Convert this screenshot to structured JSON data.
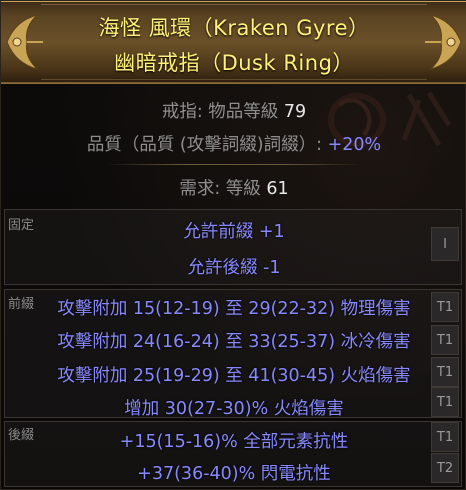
{
  "item": {
    "name_line": "海怪 風環（Kraken Gyre）",
    "base_line": "幽暗戒指（Dusk Ring）"
  },
  "properties": {
    "category_label": "戒指: 物品等級 ",
    "item_level": "79",
    "quality_label": "品質（品質 (攻擊詞綴)詞綴）: ",
    "quality_value": "+20%"
  },
  "requirements": {
    "label": "需求: 等級 ",
    "level": "61"
  },
  "sections": {
    "fixed_label": "固定",
    "prefix_label": "前綴",
    "suffix_label": "後綴"
  },
  "implicit_mods": [
    {
      "text": "允許前綴 +1"
    },
    {
      "text": "允許後綴 -1"
    }
  ],
  "implicit_marker": "I",
  "prefix_mods": [
    {
      "text": "攻擊附加 15(12-19) 至 29(22-32) 物理傷害",
      "tier": "T1"
    },
    {
      "text": "攻擊附加 24(16-24) 至 33(25-37) 冰冷傷害",
      "tier": "T1"
    },
    {
      "text": "攻擊附加 25(19-29) 至 41(30-45) 火焰傷害",
      "tier": "T1"
    },
    {
      "text": "增加 30(27-30)% 火焰傷害",
      "tier": "T1"
    }
  ],
  "suffix_mods": [
    {
      "text": "+15(15-16)% 全部元素抗性",
      "tier": "T1"
    },
    {
      "text": "+37(36-40)% 閃電抗性",
      "tier": "T2"
    }
  ],
  "colors": {
    "title": "#fff27a",
    "magic_mod": "#8888ff",
    "label_gray": "#8e8e8e",
    "value_white": "#e8e8e8",
    "header_gold": "#6b5129"
  },
  "icons": [
    "left-header-ornament-icon",
    "right-header-ornament-icon"
  ]
}
